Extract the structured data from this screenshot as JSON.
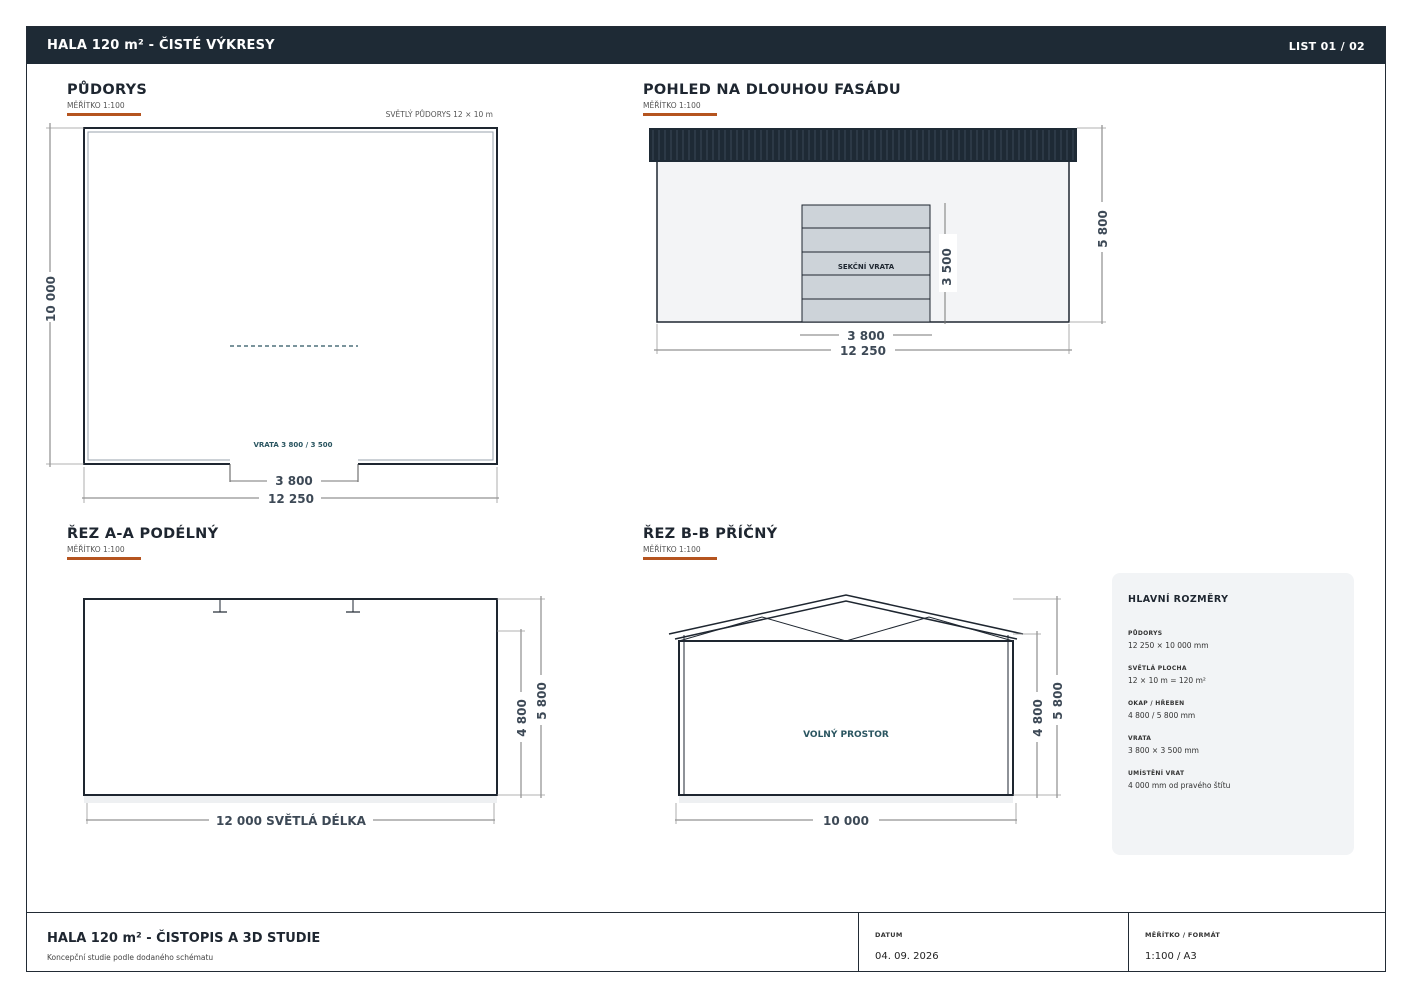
{
  "header": {
    "title": "HALA 120 m² - ČISTÉ VÝKRESY",
    "sheet": "LIST 01 / 02"
  },
  "views": {
    "plan": {
      "title": "PŮDORYS",
      "scale": "MĚŘÍTKO 1:100",
      "note": "SVĚTLÝ PŮDORYS 12 × 10 m",
      "door_label": "VRATA 3 800 / 3 500",
      "dims": {
        "height": "10 000",
        "door_width": "3 800",
        "total_width": "12 250"
      }
    },
    "facade": {
      "title": "POHLED NA DLOUHOU FASÁDU",
      "scale": "MĚŘÍTKO 1:100",
      "door_label": "SEKČNÍ VRATA",
      "dims": {
        "door_height": "3 500",
        "ridge_height": "5 800",
        "door_width": "3 800",
        "total_width": "12 250"
      }
    },
    "section_aa": {
      "title": "ŘEZ A-A PODÉLNÝ",
      "scale": "MĚŘÍTKO 1:100",
      "dims": {
        "eave_height": "4 800",
        "ridge_height": "5 800",
        "length": "12 000 SVĚTLÁ DÉLKA"
      }
    },
    "section_bb": {
      "title": "ŘEZ B-B PŘÍČNÝ",
      "scale": "MĚŘÍTKO 1:100",
      "space_label": "VOLNÝ PROSTOR",
      "dims": {
        "eave_height": "4 800",
        "ridge_height": "5 800",
        "width": "10 000"
      }
    }
  },
  "summary": {
    "heading": "HLAVNÍ ROZMĚRY",
    "items": [
      {
        "label": "PŮDORYS",
        "value": "12 250 × 10 000 mm"
      },
      {
        "label": "SVĚTLÁ PLOCHA",
        "value": "12 × 10 m = 120 m²"
      },
      {
        "label": "OKAP / HŘEBEN",
        "value": "4 800 / 5 800 mm"
      },
      {
        "label": "VRATA",
        "value": "3 800 × 3 500 mm"
      },
      {
        "label": "UMÍSTĚNÍ VRAT",
        "value": "4 000 mm od pravého štítu"
      }
    ]
  },
  "footer": {
    "title": "HALA 120 m² - ČISTOPIS A 3D STUDIE",
    "subtitle": "Koncepční studie podle dodaného schématu",
    "date_label": "DATUM",
    "date": "04. 09. 2026",
    "scale_label": "MĚŘÍTKO / FORMÁT",
    "scale": "1:100 / A3"
  },
  "colors": {
    "accent": "#b5541f",
    "dark": "#1e2a35",
    "teal": "#2a5560",
    "door": "#cdd3d9",
    "panel": "#f2f4f6"
  }
}
